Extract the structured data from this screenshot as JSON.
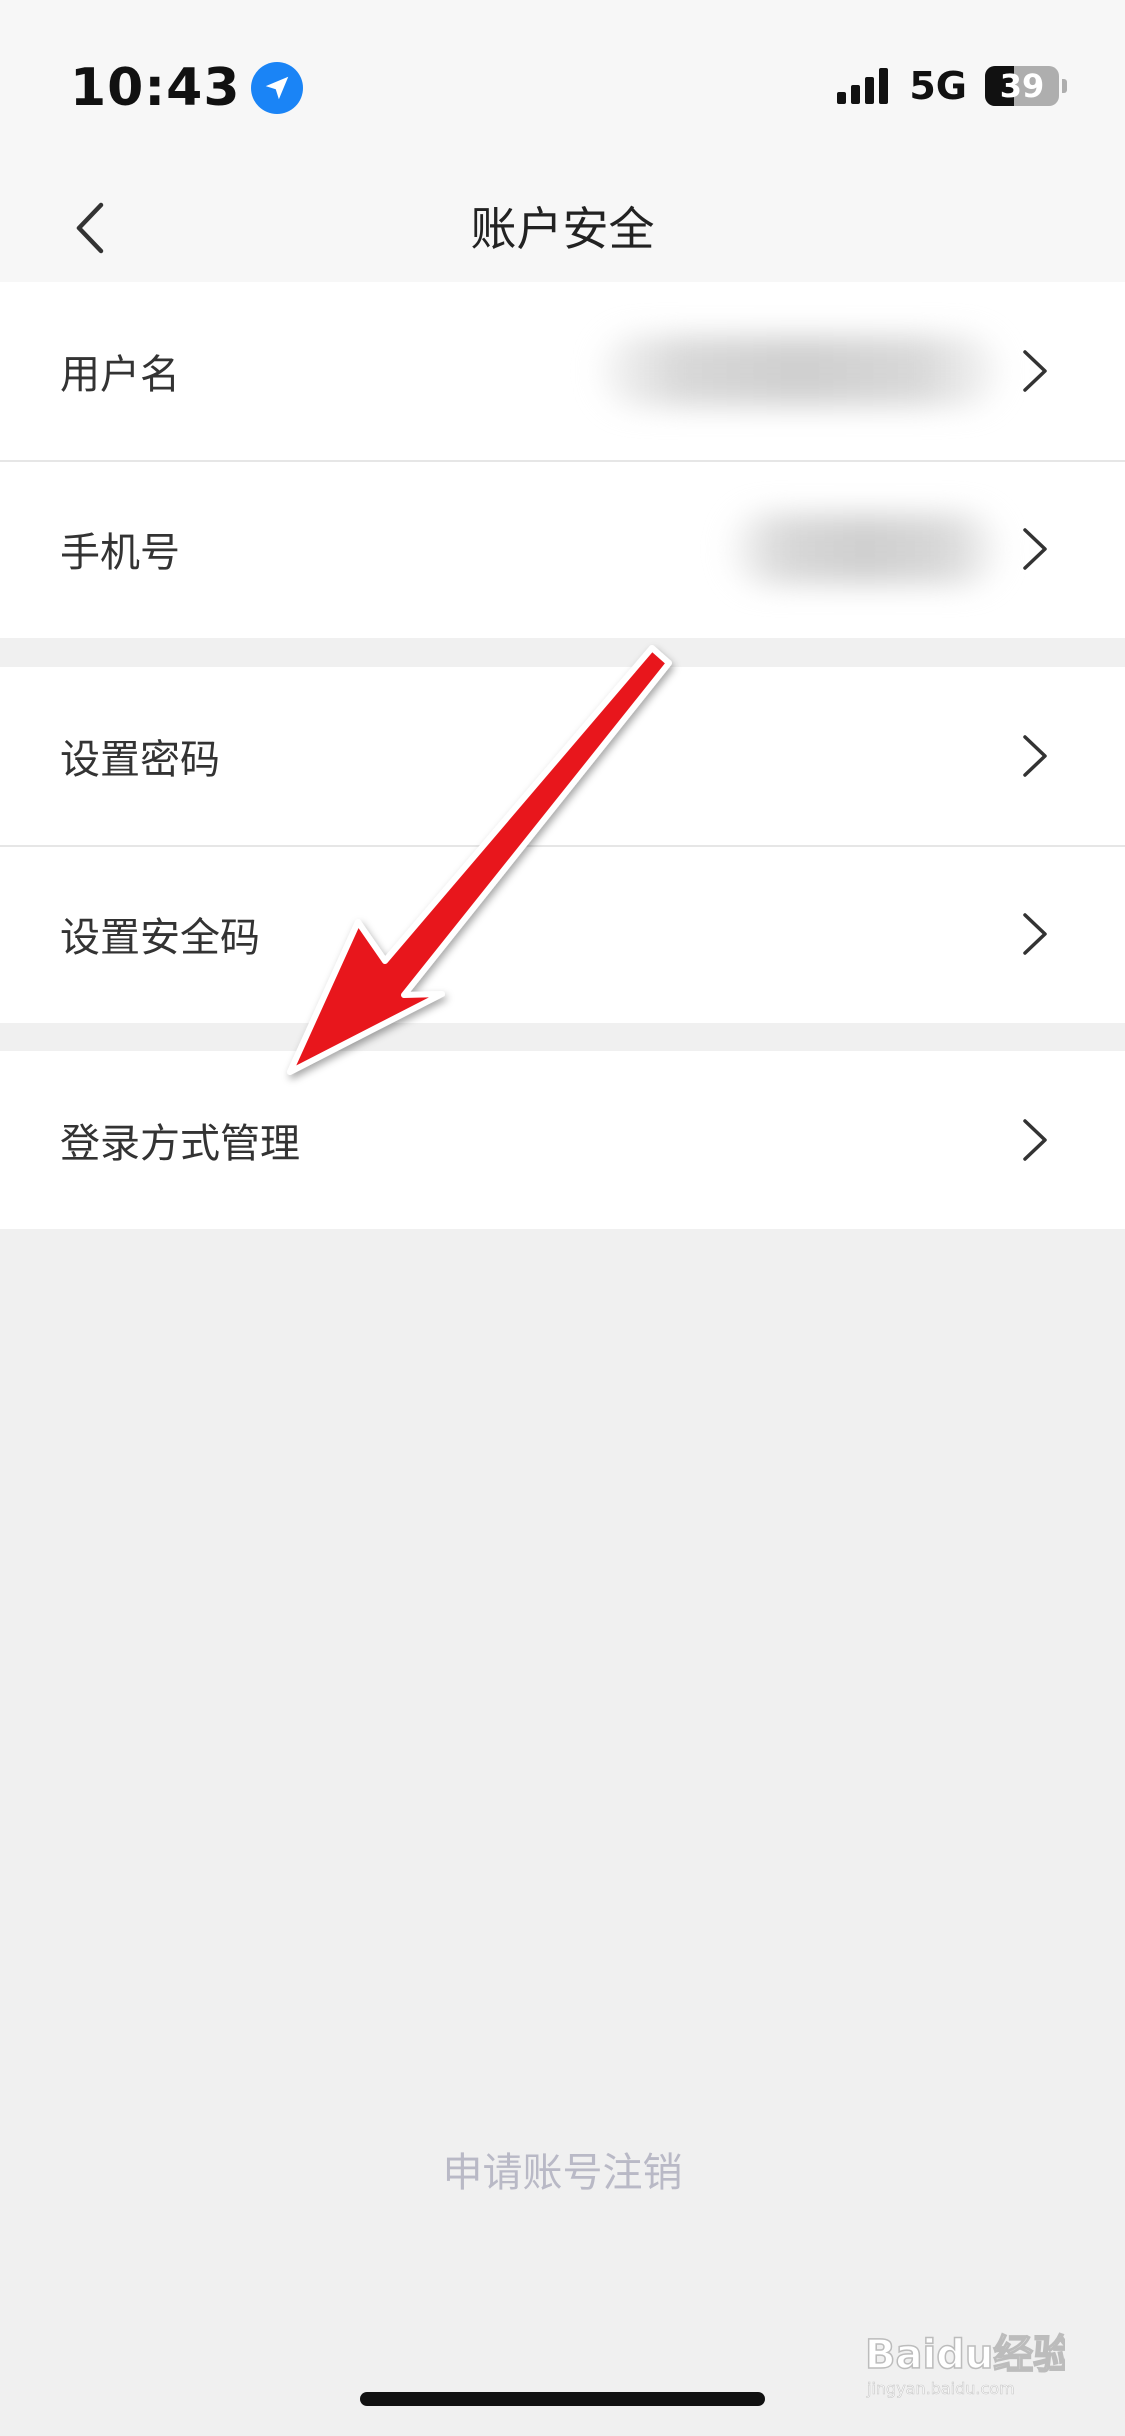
{
  "status_bar": {
    "time": "10:43",
    "network": "5G",
    "battery": "39",
    "battery_level": 0.39
  },
  "nav": {
    "title": "账户安全"
  },
  "groups": [
    {
      "rows": [
        {
          "label": "用户名"
        },
        {
          "label": "手机号"
        }
      ]
    },
    {
      "rows": [
        {
          "label": "设置密码"
        },
        {
          "label": "设置安全码"
        }
      ]
    },
    {
      "rows": [
        {
          "label": "登录方式管理"
        }
      ]
    }
  ],
  "footer": {
    "cancel_account": "申请账号注销"
  },
  "watermark": {
    "text": "Baidu经验",
    "url": "jingyan.baidu.com"
  },
  "colors": {
    "accent": "#1a84f6",
    "arrow": "#e8141c",
    "footer_text": "#b9b9c6",
    "background": "#f0f0f0"
  }
}
